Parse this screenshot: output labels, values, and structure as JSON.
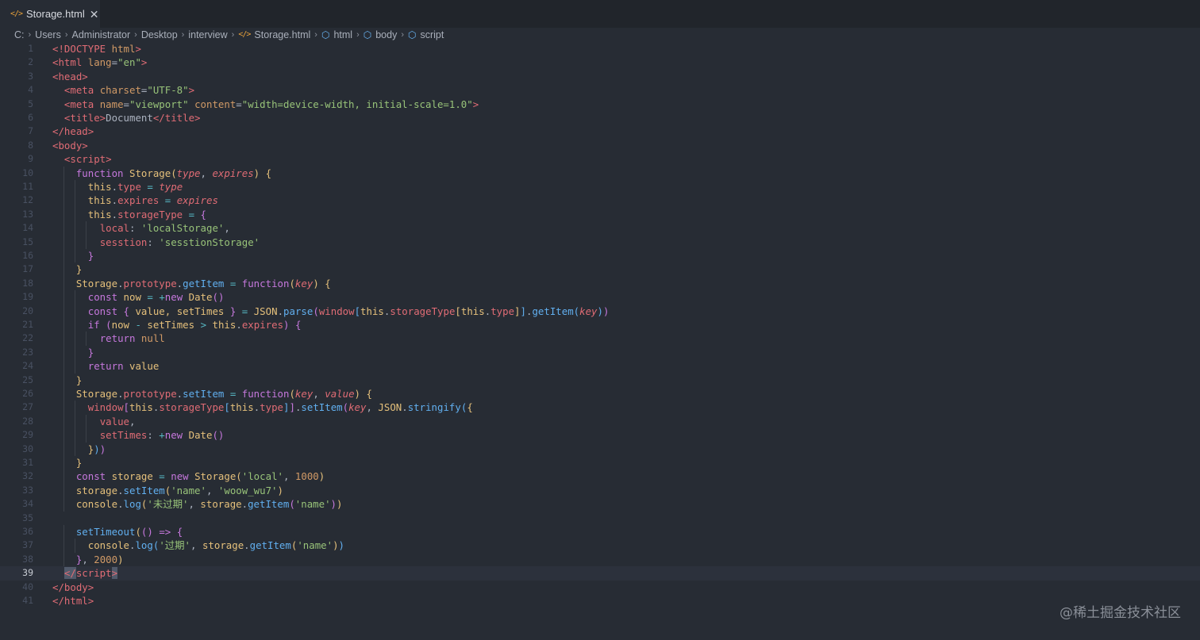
{
  "tab": {
    "icon": "html-file-icon",
    "label": "Storage.html",
    "close": "✕"
  },
  "breadcrumb": [
    {
      "label": "C:",
      "icon": ""
    },
    {
      "label": "Users",
      "icon": ""
    },
    {
      "label": "Administrator",
      "icon": ""
    },
    {
      "label": "Desktop",
      "icon": ""
    },
    {
      "label": "interview",
      "icon": ""
    },
    {
      "label": "Storage.html",
      "icon": "html-file-icon"
    },
    {
      "label": "html",
      "icon": "cube-icon"
    },
    {
      "label": "body",
      "icon": "cube-icon"
    },
    {
      "label": "script",
      "icon": "cube-icon"
    }
  ],
  "editor": {
    "current_line": 39,
    "lines": [
      [
        [
          "<!DOCTYPE ",
          "t-tag"
        ],
        [
          "html",
          "t-attr"
        ],
        [
          ">",
          "t-tag"
        ]
      ],
      [
        [
          "<html ",
          "t-tag"
        ],
        [
          "lang",
          "t-attr"
        ],
        [
          "=",
          "t-text"
        ],
        [
          "\"en\"",
          "t-str"
        ],
        [
          ">",
          "t-tag"
        ]
      ],
      [
        [
          "<head>",
          "t-tag"
        ]
      ],
      [
        [
          "  ",
          "t-text"
        ],
        [
          "<meta ",
          "t-tag"
        ],
        [
          "charset",
          "t-attr"
        ],
        [
          "=",
          "t-text"
        ],
        [
          "\"UTF-8\"",
          "t-str"
        ],
        [
          ">",
          "t-tag"
        ]
      ],
      [
        [
          "  ",
          "t-text"
        ],
        [
          "<meta ",
          "t-tag"
        ],
        [
          "name",
          "t-attr"
        ],
        [
          "=",
          "t-text"
        ],
        [
          "\"viewport\"",
          "t-str"
        ],
        [
          " ",
          "t-text"
        ],
        [
          "content",
          "t-attr"
        ],
        [
          "=",
          "t-text"
        ],
        [
          "\"width=device-width, initial-scale=1.0\"",
          "t-str"
        ],
        [
          ">",
          "t-tag"
        ]
      ],
      [
        [
          "  ",
          "t-text"
        ],
        [
          "<title>",
          "t-tag"
        ],
        [
          "Document",
          "t-text"
        ],
        [
          "</title>",
          "t-tag"
        ]
      ],
      [
        [
          "</head>",
          "t-tag"
        ]
      ],
      [
        [
          "<body>",
          "t-tag"
        ]
      ],
      [
        [
          "  ",
          "t-text"
        ],
        [
          "<script>",
          "t-tag"
        ]
      ],
      [
        [
          "    ",
          "t-text"
        ],
        [
          "function ",
          "t-kw"
        ],
        [
          "Storage",
          "t-cls"
        ],
        [
          "(",
          "t-bracket-y"
        ],
        [
          "type",
          "t-param"
        ],
        [
          ", ",
          "t-punc"
        ],
        [
          "expires",
          "t-param"
        ],
        [
          ")",
          "t-bracket-y"
        ],
        [
          " ",
          "t-text"
        ],
        [
          "{",
          "t-bracket-y"
        ]
      ],
      [
        [
          "      ",
          "t-text"
        ],
        [
          "this",
          "t-this"
        ],
        [
          ".",
          "t-punc"
        ],
        [
          "type",
          "t-prop"
        ],
        [
          " ",
          "t-text"
        ],
        [
          "=",
          "t-op"
        ],
        [
          " ",
          "t-text"
        ],
        [
          "type",
          "t-param"
        ]
      ],
      [
        [
          "      ",
          "t-text"
        ],
        [
          "this",
          "t-this"
        ],
        [
          ".",
          "t-punc"
        ],
        [
          "expires",
          "t-prop"
        ],
        [
          " ",
          "t-text"
        ],
        [
          "=",
          "t-op"
        ],
        [
          " ",
          "t-text"
        ],
        [
          "expires",
          "t-param"
        ]
      ],
      [
        [
          "      ",
          "t-text"
        ],
        [
          "this",
          "t-this"
        ],
        [
          ".",
          "t-punc"
        ],
        [
          "storageType",
          "t-prop"
        ],
        [
          " ",
          "t-text"
        ],
        [
          "=",
          "t-op"
        ],
        [
          " ",
          "t-text"
        ],
        [
          "{",
          "t-bracket-p"
        ]
      ],
      [
        [
          "        ",
          "t-text"
        ],
        [
          "local",
          "t-prop"
        ],
        [
          ": ",
          "t-punc"
        ],
        [
          "'localStorage'",
          "t-str"
        ],
        [
          ",",
          "t-punc"
        ]
      ],
      [
        [
          "        ",
          "t-text"
        ],
        [
          "sesstion",
          "t-prop"
        ],
        [
          ": ",
          "t-punc"
        ],
        [
          "'sesstionStorage'",
          "t-str"
        ]
      ],
      [
        [
          "      ",
          "t-text"
        ],
        [
          "}",
          "t-bracket-p"
        ]
      ],
      [
        [
          "    ",
          "t-text"
        ],
        [
          "}",
          "t-bracket-y"
        ]
      ],
      [
        [
          "    ",
          "t-text"
        ],
        [
          "Storage",
          "t-var"
        ],
        [
          ".",
          "t-punc"
        ],
        [
          "prototype",
          "t-prop"
        ],
        [
          ".",
          "t-punc"
        ],
        [
          "getItem",
          "t-fn"
        ],
        [
          " ",
          "t-text"
        ],
        [
          "=",
          "t-op"
        ],
        [
          " ",
          "t-text"
        ],
        [
          "function",
          "t-kw"
        ],
        [
          "(",
          "t-bracket-y"
        ],
        [
          "key",
          "t-param"
        ],
        [
          ")",
          "t-bracket-y"
        ],
        [
          " ",
          "t-text"
        ],
        [
          "{",
          "t-bracket-y"
        ]
      ],
      [
        [
          "      ",
          "t-text"
        ],
        [
          "const ",
          "t-kw"
        ],
        [
          "now",
          "t-var"
        ],
        [
          " ",
          "t-text"
        ],
        [
          "=",
          "t-op"
        ],
        [
          " ",
          "t-text"
        ],
        [
          "+",
          "t-op"
        ],
        [
          "new ",
          "t-kw"
        ],
        [
          "Date",
          "t-cls"
        ],
        [
          "(",
          "t-bracket-p"
        ],
        [
          ")",
          "t-bracket-p"
        ]
      ],
      [
        [
          "      ",
          "t-text"
        ],
        [
          "const ",
          "t-kw"
        ],
        [
          "{",
          "t-bracket-p"
        ],
        [
          " value, ",
          "t-var"
        ],
        [
          "setTimes",
          "t-var"
        ],
        [
          " ",
          "t-text"
        ],
        [
          "}",
          "t-bracket-p"
        ],
        [
          " ",
          "t-text"
        ],
        [
          "=",
          "t-op"
        ],
        [
          " ",
          "t-text"
        ],
        [
          "JSON",
          "t-var"
        ],
        [
          ".",
          "t-punc"
        ],
        [
          "parse",
          "t-fn"
        ],
        [
          "(",
          "t-bracket-p"
        ],
        [
          "window",
          "t-prop"
        ],
        [
          "[",
          "t-bracket-b"
        ],
        [
          "this",
          "t-this"
        ],
        [
          ".",
          "t-punc"
        ],
        [
          "storageType",
          "t-prop"
        ],
        [
          "[",
          "t-bracket-y"
        ],
        [
          "this",
          "t-this"
        ],
        [
          ".",
          "t-punc"
        ],
        [
          "type",
          "t-prop"
        ],
        [
          "]",
          "t-bracket-y"
        ],
        [
          "]",
          "t-bracket-b"
        ],
        [
          ".",
          "t-punc"
        ],
        [
          "getItem",
          "t-fn"
        ],
        [
          "(",
          "t-bracket-b"
        ],
        [
          "key",
          "t-param"
        ],
        [
          ")",
          "t-bracket-b"
        ],
        [
          ")",
          "t-bracket-p"
        ]
      ],
      [
        [
          "      ",
          "t-text"
        ],
        [
          "if ",
          "t-kw"
        ],
        [
          "(",
          "t-bracket-p"
        ],
        [
          "now",
          "t-var"
        ],
        [
          " ",
          "t-text"
        ],
        [
          "-",
          "t-op"
        ],
        [
          " ",
          "t-text"
        ],
        [
          "setTimes",
          "t-var"
        ],
        [
          " ",
          "t-text"
        ],
        [
          ">",
          "t-op"
        ],
        [
          " ",
          "t-text"
        ],
        [
          "this",
          "t-this"
        ],
        [
          ".",
          "t-punc"
        ],
        [
          "expires",
          "t-prop"
        ],
        [
          ")",
          "t-bracket-p"
        ],
        [
          " ",
          "t-text"
        ],
        [
          "{",
          "t-bracket-p"
        ]
      ],
      [
        [
          "        ",
          "t-text"
        ],
        [
          "return ",
          "t-kw"
        ],
        [
          "null",
          "t-num"
        ]
      ],
      [
        [
          "      ",
          "t-text"
        ],
        [
          "}",
          "t-bracket-p"
        ]
      ],
      [
        [
          "      ",
          "t-text"
        ],
        [
          "return ",
          "t-kw"
        ],
        [
          "value",
          "t-var"
        ]
      ],
      [
        [
          "    ",
          "t-text"
        ],
        [
          "}",
          "t-bracket-y"
        ]
      ],
      [
        [
          "    ",
          "t-text"
        ],
        [
          "Storage",
          "t-var"
        ],
        [
          ".",
          "t-punc"
        ],
        [
          "prototype",
          "t-prop"
        ],
        [
          ".",
          "t-punc"
        ],
        [
          "setItem",
          "t-fn"
        ],
        [
          " ",
          "t-text"
        ],
        [
          "=",
          "t-op"
        ],
        [
          " ",
          "t-text"
        ],
        [
          "function",
          "t-kw"
        ],
        [
          "(",
          "t-bracket-y"
        ],
        [
          "key",
          "t-param"
        ],
        [
          ", ",
          "t-punc"
        ],
        [
          "value",
          "t-param"
        ],
        [
          ")",
          "t-bracket-y"
        ],
        [
          " ",
          "t-text"
        ],
        [
          "{",
          "t-bracket-y"
        ]
      ],
      [
        [
          "      ",
          "t-text"
        ],
        [
          "window",
          "t-prop"
        ],
        [
          "[",
          "t-bracket-p"
        ],
        [
          "this",
          "t-this"
        ],
        [
          ".",
          "t-punc"
        ],
        [
          "storageType",
          "t-prop"
        ],
        [
          "[",
          "t-bracket-b"
        ],
        [
          "this",
          "t-this"
        ],
        [
          ".",
          "t-punc"
        ],
        [
          "type",
          "t-prop"
        ],
        [
          "]",
          "t-bracket-b"
        ],
        [
          "]",
          "t-bracket-p"
        ],
        [
          ".",
          "t-punc"
        ],
        [
          "setItem",
          "t-fn"
        ],
        [
          "(",
          "t-bracket-p"
        ],
        [
          "key",
          "t-param"
        ],
        [
          ", ",
          "t-punc"
        ],
        [
          "JSON",
          "t-var"
        ],
        [
          ".",
          "t-punc"
        ],
        [
          "stringify",
          "t-fn"
        ],
        [
          "(",
          "t-bracket-b"
        ],
        [
          "{",
          "t-bracket-y"
        ]
      ],
      [
        [
          "        ",
          "t-text"
        ],
        [
          "value",
          "t-prop"
        ],
        [
          ",",
          "t-punc"
        ]
      ],
      [
        [
          "        ",
          "t-text"
        ],
        [
          "setTimes",
          "t-prop"
        ],
        [
          ": ",
          "t-punc"
        ],
        [
          "+",
          "t-op"
        ],
        [
          "new ",
          "t-kw"
        ],
        [
          "Date",
          "t-cls"
        ],
        [
          "(",
          "t-bracket-p"
        ],
        [
          ")",
          "t-bracket-p"
        ]
      ],
      [
        [
          "      ",
          "t-text"
        ],
        [
          "}",
          "t-bracket-y"
        ],
        [
          ")",
          "t-bracket-b"
        ],
        [
          ")",
          "t-bracket-p"
        ]
      ],
      [
        [
          "    ",
          "t-text"
        ],
        [
          "}",
          "t-bracket-y"
        ]
      ],
      [
        [
          "    ",
          "t-text"
        ],
        [
          "const ",
          "t-kw"
        ],
        [
          "storage",
          "t-var"
        ],
        [
          " ",
          "t-text"
        ],
        [
          "=",
          "t-op"
        ],
        [
          " ",
          "t-text"
        ],
        [
          "new ",
          "t-kw"
        ],
        [
          "Storage",
          "t-cls"
        ],
        [
          "(",
          "t-bracket-y"
        ],
        [
          "'local'",
          "t-str"
        ],
        [
          ", ",
          "t-punc"
        ],
        [
          "1000",
          "t-num"
        ],
        [
          ")",
          "t-bracket-y"
        ]
      ],
      [
        [
          "    ",
          "t-text"
        ],
        [
          "storage",
          "t-var"
        ],
        [
          ".",
          "t-punc"
        ],
        [
          "setItem",
          "t-fn"
        ],
        [
          "(",
          "t-bracket-y"
        ],
        [
          "'name'",
          "t-str"
        ],
        [
          ", ",
          "t-punc"
        ],
        [
          "'woow_wu7'",
          "t-str"
        ],
        [
          ")",
          "t-bracket-y"
        ]
      ],
      [
        [
          "    ",
          "t-text"
        ],
        [
          "console",
          "t-var"
        ],
        [
          ".",
          "t-punc"
        ],
        [
          "log",
          "t-fn"
        ],
        [
          "(",
          "t-bracket-y"
        ],
        [
          "'未过期'",
          "t-str"
        ],
        [
          ", ",
          "t-punc"
        ],
        [
          "storage",
          "t-var"
        ],
        [
          ".",
          "t-punc"
        ],
        [
          "getItem",
          "t-fn"
        ],
        [
          "(",
          "t-bracket-p"
        ],
        [
          "'name'",
          "t-str"
        ],
        [
          ")",
          "t-bracket-p"
        ],
        [
          ")",
          "t-bracket-y"
        ]
      ],
      [
        [
          "",
          "t-text"
        ]
      ],
      [
        [
          "    ",
          "t-text"
        ],
        [
          "setTimeout",
          "t-fn"
        ],
        [
          "(",
          "t-bracket-y"
        ],
        [
          "(",
          "t-bracket-p"
        ],
        [
          ")",
          "t-bracket-p"
        ],
        [
          " ",
          "t-text"
        ],
        [
          "=>",
          "t-kw"
        ],
        [
          " ",
          "t-text"
        ],
        [
          "{",
          "t-bracket-p"
        ]
      ],
      [
        [
          "      ",
          "t-text"
        ],
        [
          "console",
          "t-var"
        ],
        [
          ".",
          "t-punc"
        ],
        [
          "log",
          "t-fn"
        ],
        [
          "(",
          "t-bracket-b"
        ],
        [
          "'过期'",
          "t-str"
        ],
        [
          ", ",
          "t-punc"
        ],
        [
          "storage",
          "t-var"
        ],
        [
          ".",
          "t-punc"
        ],
        [
          "getItem",
          "t-fn"
        ],
        [
          "(",
          "t-bracket-y"
        ],
        [
          "'name'",
          "t-str"
        ],
        [
          ")",
          "t-bracket-y"
        ],
        [
          ")",
          "t-bracket-b"
        ]
      ],
      [
        [
          "    ",
          "t-text"
        ],
        [
          "}",
          "t-bracket-p"
        ],
        [
          ", ",
          "t-punc"
        ],
        [
          "2000",
          "t-num"
        ],
        [
          ")",
          "t-bracket-y"
        ]
      ],
      [
        [
          "  ",
          "t-text"
        ],
        [
          "</",
          "t-tag t-sel"
        ],
        [
          "script",
          "t-tag"
        ],
        [
          ">",
          "t-tag t-sel"
        ]
      ],
      [
        [
          "</body>",
          "t-tag"
        ]
      ],
      [
        [
          "</html>",
          "t-tag"
        ]
      ]
    ]
  },
  "watermark": "@稀土掘金技术社区"
}
